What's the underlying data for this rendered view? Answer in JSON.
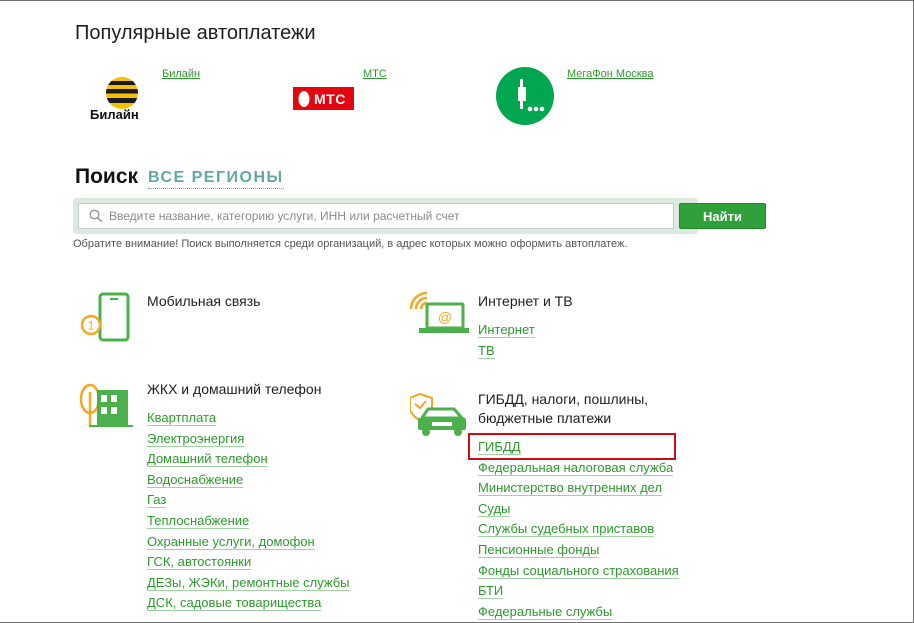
{
  "popular": {
    "title": "Популярные автоплатежи",
    "items": [
      {
        "name": "Билайн",
        "logo_text": "Билайн"
      },
      {
        "name": "МТС",
        "logo_text": "МТС"
      },
      {
        "name": "МегаФон Москва"
      }
    ]
  },
  "search": {
    "title": "Поиск",
    "region_link": "ВСЕ РЕГИОНЫ",
    "placeholder": "Введите название, категорию услуги, ИНН или расчетный счет",
    "button": "Найти",
    "note": "Обратите внимание! Поиск выполняется среди организаций, в адрес которых можно оформить автоплатеж."
  },
  "categories": [
    {
      "title": "Мобильная связь",
      "icon": "mobile-phone-icon",
      "links": []
    },
    {
      "title": "Интернет и ТВ",
      "icon": "laptop-wifi-icon",
      "links": [
        "Интернет",
        "ТВ"
      ]
    },
    {
      "title": "ЖКХ и домашний телефон",
      "icon": "house-tree-icon",
      "links": [
        "Квартплата",
        "Электроэнергия",
        "Домашний телефон",
        "Водоснабжение",
        "Газ",
        "Теплоснабжение",
        "Охранные услуги, домофон",
        "ГСК, автостоянки",
        "ДЕЗы, ЖЭКи, ремонтные службы",
        "ДСК, садовые товарищества"
      ]
    },
    {
      "title": "ГИБДД, налоги, пошлины, бюджетные платежи",
      "title_line1": "ГИБДД, налоги, пошлины,",
      "title_line2": "бюджетные платежи",
      "icon": "car-emblem-icon",
      "links": [
        "ГИБДД",
        "Федеральная налоговая служба",
        "Министерство внутренних дел",
        "Суды",
        "Службы судебных приставов",
        "Пенсионные фонды",
        "Фонды социального страхования",
        "БТИ",
        "Федеральные службы"
      ]
    }
  ],
  "colors": {
    "link_green": "#2c9a2c",
    "button_green": "#2fa03a",
    "highlight_red": "#d10a10",
    "region_teal": "#62a8a0"
  }
}
